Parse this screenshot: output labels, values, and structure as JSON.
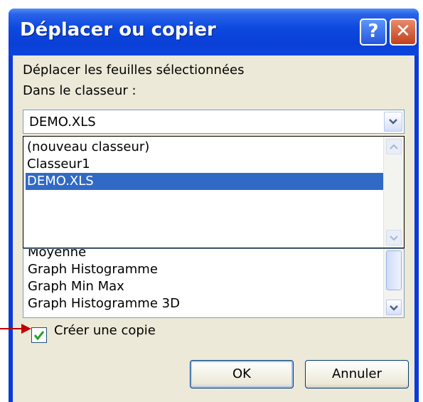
{
  "dialog": {
    "title": "Déplacer ou copier",
    "help_glyph": "?",
    "close_glyph": "✕",
    "move_label": "Déplacer les feuilles sélectionnées",
    "workbook_label": "Dans le classeur :",
    "workbook_selected": "DEMO.XLS",
    "workbook_options": [
      "(nouveau classeur)",
      "Classeur1",
      "DEMO.XLS"
    ],
    "sheets_visible": [
      "Moyenne",
      "Graph Histogramme",
      "Graph Min Max",
      "Graph Histogramme 3D"
    ],
    "copy_label": "Créer une copie",
    "copy_checked": true,
    "ok_label": "OK",
    "cancel_label": "Annuler"
  },
  "colors": {
    "titlebar": "#0a3fd6",
    "selection": "#316ac5",
    "dialog_bg": "#ece9d8",
    "annotation_arrow": "#c00000"
  }
}
